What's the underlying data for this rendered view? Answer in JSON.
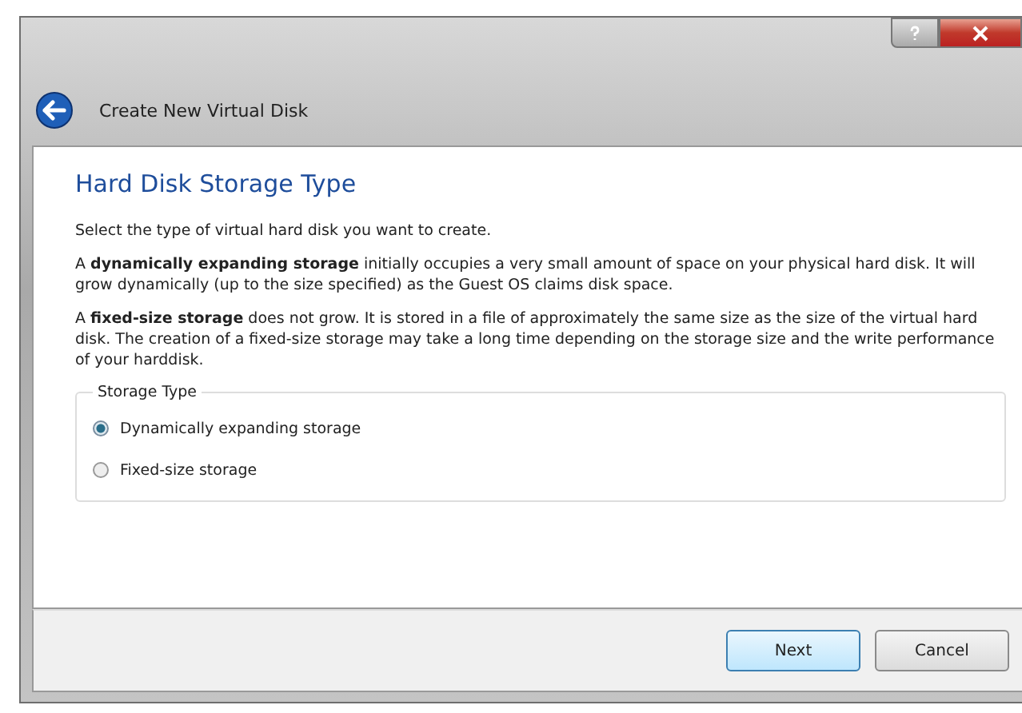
{
  "window": {
    "title": "Create New Virtual Disk"
  },
  "page": {
    "heading": "Hard Disk Storage Type",
    "paragraphs": [
      "Select the type of virtual hard disk you want to create.",
      "A **dynamically expanding storage** initially occupies a very small amount of space on your physical hard disk. It will grow dynamically (up to the size specified) as the Guest OS claims disk space.",
      "A **fixed-size storage** does not grow. It is stored in a file of approximately the same size as the size of the virtual hard disk. The creation of a fixed-size storage may take a long time depending on the storage size and the write performance of your harddisk."
    ],
    "group": {
      "title": "Storage Type",
      "options": [
        {
          "label": "Dynamically expanding storage",
          "selected": true
        },
        {
          "label": "Fixed-size storage",
          "selected": false
        }
      ]
    }
  },
  "buttons": [
    {
      "label": "Next",
      "default": true
    },
    {
      "label": "Cancel",
      "default": false
    }
  ]
}
